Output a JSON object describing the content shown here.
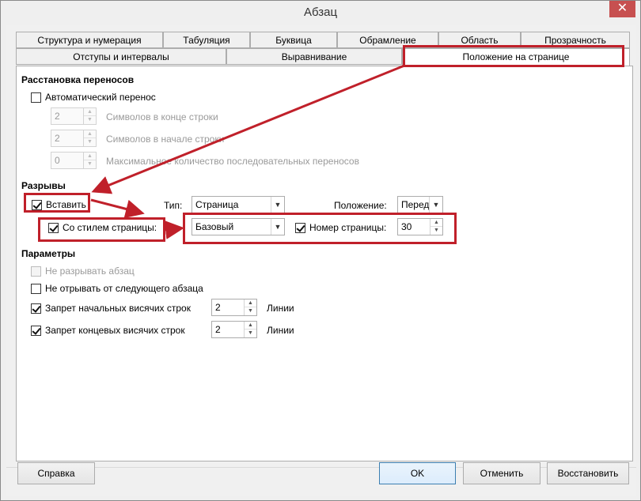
{
  "window": {
    "title": "Абзац",
    "close_glyph": "✕"
  },
  "tabs_row1": [
    "Структура и нумерация",
    "Табуляция",
    "Буквица",
    "Обрамление",
    "Область",
    "Прозрачность"
  ],
  "tabs_row2": [
    "Отступы и интервалы",
    "Выравнивание",
    "Положение на странице"
  ],
  "hyphenation": {
    "title": "Расстановка переносов",
    "auto_label": "Автоматический перенос",
    "chars_end_value": "2",
    "chars_end_label": "Символов в конце строки",
    "chars_start_value": "2",
    "chars_start_label": "Символов в начале строки",
    "max_value": "0",
    "max_label": "Максимальное количество последовательных переносов"
  },
  "breaks": {
    "title": "Разрывы",
    "insert_label": "Вставить",
    "type_label": "Тип:",
    "type_value": "Страница",
    "position_label": "Положение:",
    "position_value": "Перед",
    "with_style_label": "Со стилем страницы:",
    "style_value": "Базовый",
    "page_number_label": "Номер страницы:",
    "page_number_value": "30"
  },
  "options": {
    "title": "Параметры",
    "dont_split_label": "Не разрывать абзац",
    "keep_next_label": "Не отрывать от следующего абзаца",
    "orphan_label": "Запрет начальных висячих строк",
    "orphan_value": "2",
    "orphan_unit": "Линии",
    "widow_label": "Запрет концевых висячих строк",
    "widow_value": "2",
    "widow_unit": "Линии"
  },
  "buttons": {
    "help": "Справка",
    "ok": "OK",
    "cancel": "Отменить",
    "reset": "Восстановить"
  },
  "annotation_color": "#c0202a"
}
